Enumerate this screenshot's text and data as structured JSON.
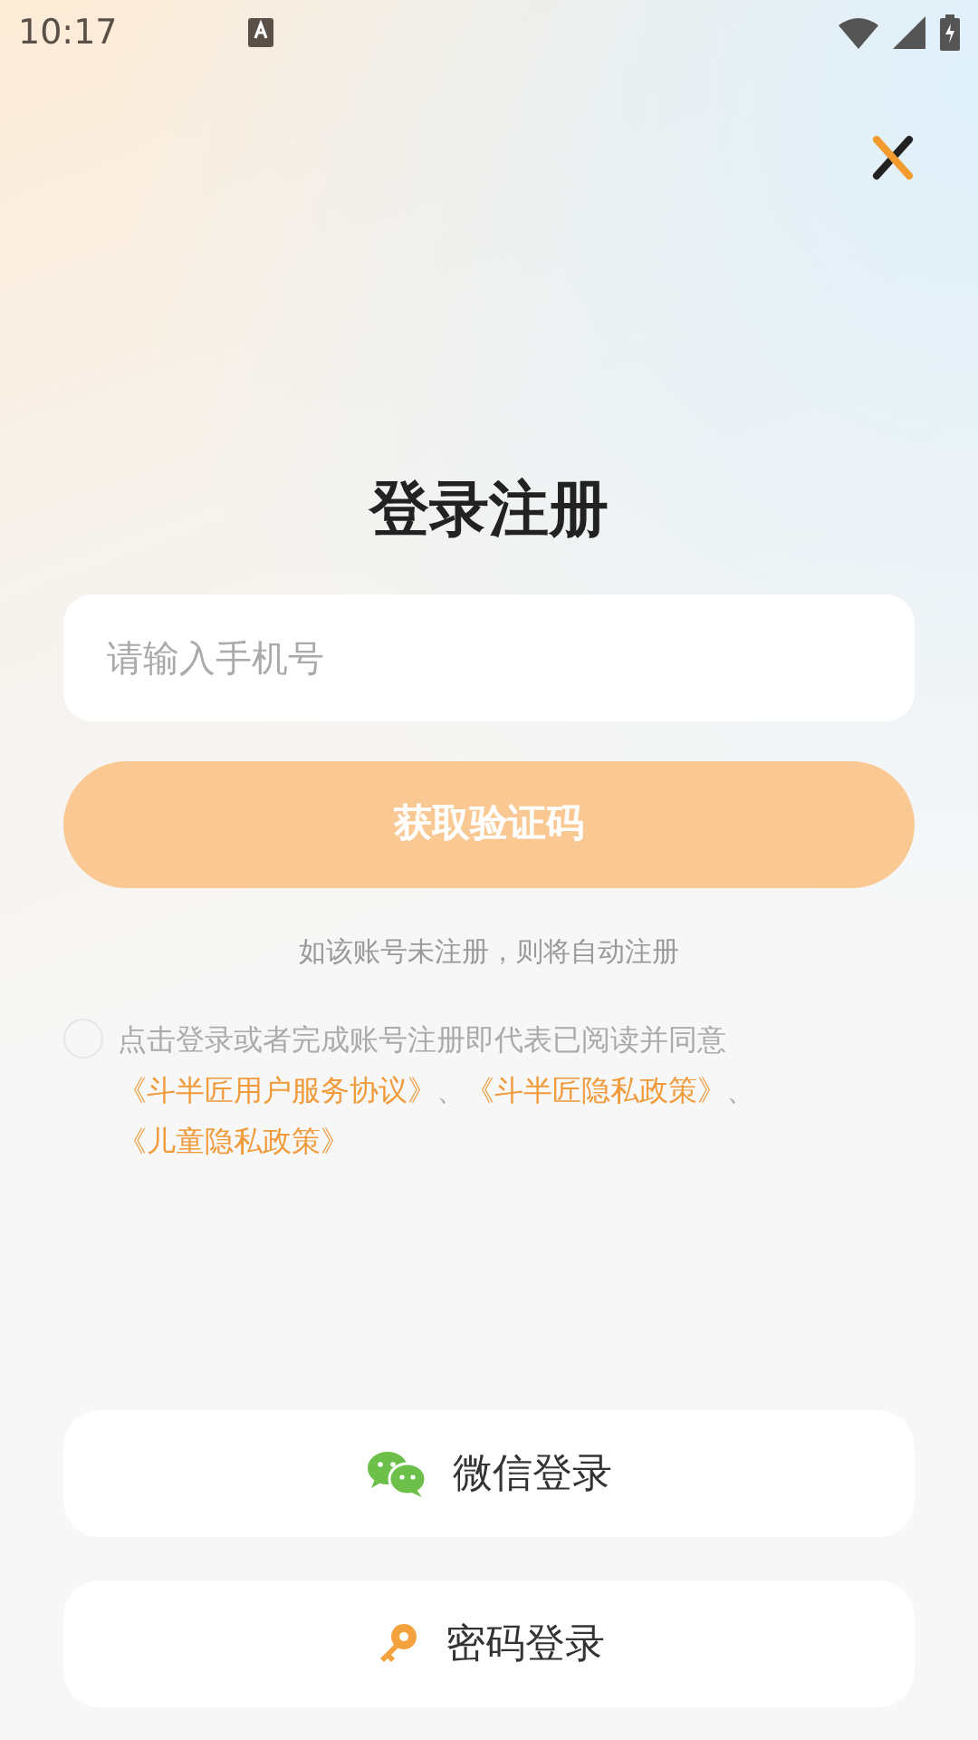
{
  "status_bar": {
    "time": "10:17"
  },
  "title": "登录注册",
  "phone_field": {
    "placeholder": "请输入手机号"
  },
  "code_button": {
    "label": "获取验证码",
    "disabled": true
  },
  "hint": "如该账号未注册，则将自动注册",
  "agreement": {
    "checked": false,
    "segments": [
      {
        "kind": "text",
        "text": "点击登录或者完成账号注册即代表已阅读并同意"
      },
      {
        "kind": "link",
        "text": "《斗半匠用户服务协议》"
      },
      {
        "kind": "text",
        "text": "、"
      },
      {
        "kind": "link",
        "text": "《斗半匠隐私政策》"
      },
      {
        "kind": "text",
        "text": "、"
      },
      {
        "kind": "link",
        "text": "《儿童隐私政策》"
      }
    ]
  },
  "alt_logins": [
    {
      "kind": "wechat",
      "label": "微信登录"
    },
    {
      "kind": "password",
      "label": "密码登录"
    }
  ]
}
